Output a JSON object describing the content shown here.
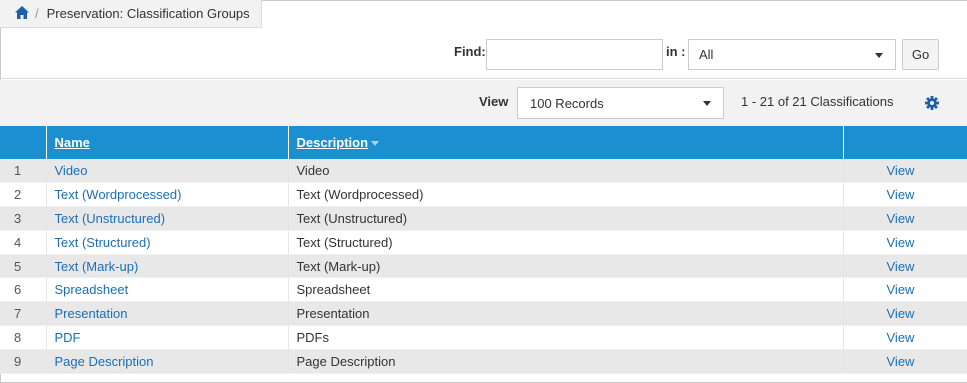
{
  "breadcrumb": {
    "separator": "/",
    "title": "Preservation: Classification Groups"
  },
  "search": {
    "find_label": "Find:",
    "find_value": "",
    "in_label": "in :",
    "in_value": "All",
    "go_label": "Go"
  },
  "view": {
    "label": "View",
    "records_value": "100 Records",
    "count_text": "1 - 21 of 21 Classifications"
  },
  "table": {
    "columns": [
      "",
      "Name",
      "Description",
      ""
    ],
    "rows": [
      {
        "num": "1",
        "name": "Video",
        "description": "Video",
        "action": "View"
      },
      {
        "num": "2",
        "name": "Text (Wordprocessed)",
        "description": "Text (Wordprocessed)",
        "action": "View"
      },
      {
        "num": "3",
        "name": "Text (Unstructured)",
        "description": "Text (Unstructured)",
        "action": "View"
      },
      {
        "num": "4",
        "name": "Text (Structured)",
        "description": "Text (Structured)",
        "action": "View"
      },
      {
        "num": "5",
        "name": "Text (Mark-up)",
        "description": "Text (Mark-up)",
        "action": "View"
      },
      {
        "num": "6",
        "name": "Spreadsheet",
        "description": "Spreadsheet",
        "action": "View"
      },
      {
        "num": "7",
        "name": "Presentation",
        "description": "Presentation",
        "action": "View"
      },
      {
        "num": "8",
        "name": "PDF",
        "description": "PDFs",
        "action": "View"
      },
      {
        "num": "9",
        "name": "Page Description",
        "description": "Page Description",
        "action": "View"
      }
    ]
  },
  "colors": {
    "header_blue": "#1b8fcf",
    "link_blue": "#1a6fb5",
    "home_icon": "#1c5fa8",
    "alt_row": "#e8e8e8"
  },
  "icons": {
    "home": "home-icon",
    "gear": "gear-icon",
    "dropdown": "chevron-down-icon",
    "sort": "sort-desc-icon"
  }
}
